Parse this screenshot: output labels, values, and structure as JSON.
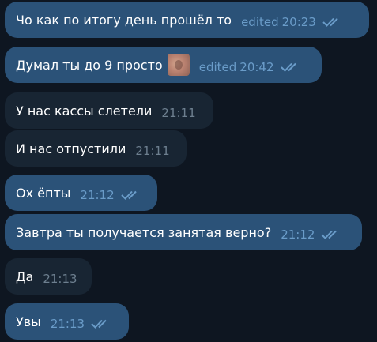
{
  "messages": [
    {
      "text": "Чо как по итогу день прошёл то",
      "edited": "edited",
      "time": "20:23",
      "direction": "out",
      "status": "read"
    },
    {
      "text": "Думал ты до 9 просто",
      "edited": "edited",
      "time": "20:42",
      "direction": "out",
      "status": "read",
      "emoji": "sticker-emoji"
    },
    {
      "text": "У нас кассы слетели",
      "time": "21:11",
      "direction": "in"
    },
    {
      "text": "И нас отпустили",
      "time": "21:11",
      "direction": "in"
    },
    {
      "text": "Ох ёпты",
      "time": "21:12",
      "direction": "out",
      "status": "read"
    },
    {
      "text": "Завтра ты получается занятая верно?",
      "time": "21:12",
      "direction": "out",
      "status": "read"
    },
    {
      "text": "Да",
      "time": "21:13",
      "direction": "in"
    },
    {
      "text": "Увы",
      "time": "21:13",
      "direction": "out",
      "status": "read"
    }
  ],
  "colors": {
    "background": "#0e1621",
    "outgoing_bubble": "#2b5278",
    "incoming_bubble": "#182533",
    "read_check": "#6a9cc9"
  }
}
